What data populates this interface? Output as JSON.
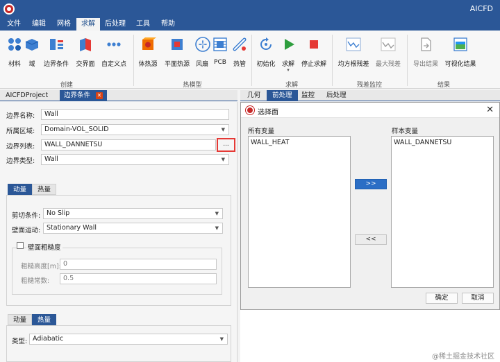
{
  "app_title": "AICFD",
  "menu": [
    "文件",
    "编辑",
    "网格",
    "求解",
    "后处理",
    "工具",
    "帮助"
  ],
  "ribbon": {
    "groups": [
      "创建",
      "热模型",
      "求解",
      "残差监控",
      "结果"
    ],
    "buttons": [
      "材料",
      "域",
      "边界条件",
      "交界面",
      "自定义点",
      "体热源",
      "平面热源",
      "风扇",
      "PCB",
      "热管",
      "初始化",
      "求解",
      "停止求解",
      "均方根残差",
      "最大残差",
      "导出结果",
      "可视化结果"
    ]
  },
  "doc_tabs": {
    "project": "AICFDProject",
    "boundary": "边界条件"
  },
  "right_tabs": [
    "几何",
    "前处理",
    "监控",
    "后处理"
  ],
  "form": {
    "name_label": "边界名称:",
    "name_value": "Wall",
    "region_label": "所属区域:",
    "region_value": "Domain-VOL_SOLID",
    "list_label": "边界列表:",
    "list_value": "WALL_DANNETSU",
    "list_button": "...",
    "type_label": "边界类型:",
    "type_value": "Wall"
  },
  "tabs1": {
    "momentum": "动量",
    "heat": "热量"
  },
  "momentum": {
    "shear_label": "剪切条件:",
    "shear_value": "No Slip",
    "motion_label": "壁面运动:",
    "motion_value": "Stationary Wall",
    "roughness_label": "壁面粗糙度",
    "height_label": "粗糙高度[m]:",
    "height_value": "0",
    "constant_label": "粗糙常数:",
    "constant_value": "0.5"
  },
  "tabs2": {
    "momentum": "动量",
    "heat": "热量"
  },
  "heat": {
    "type_label": "类型:",
    "type_value": "Adiabatic"
  },
  "dialog": {
    "title": "选择面",
    "all_label": "所有变量",
    "sample_label": "样本变量",
    "all_items": [
      "WALL_HEAT"
    ],
    "sample_items": [
      "WALL_DANNETSU"
    ],
    "add_button": ">>",
    "remove_button": "<<",
    "ok": "确定",
    "cancel": "取消"
  },
  "watermark": "@稀土掘金技术社区",
  "colors": {
    "brand_blue": "#2b5797",
    "highlight_red": "#e53935",
    "primary_button": "#2b6ec5"
  }
}
